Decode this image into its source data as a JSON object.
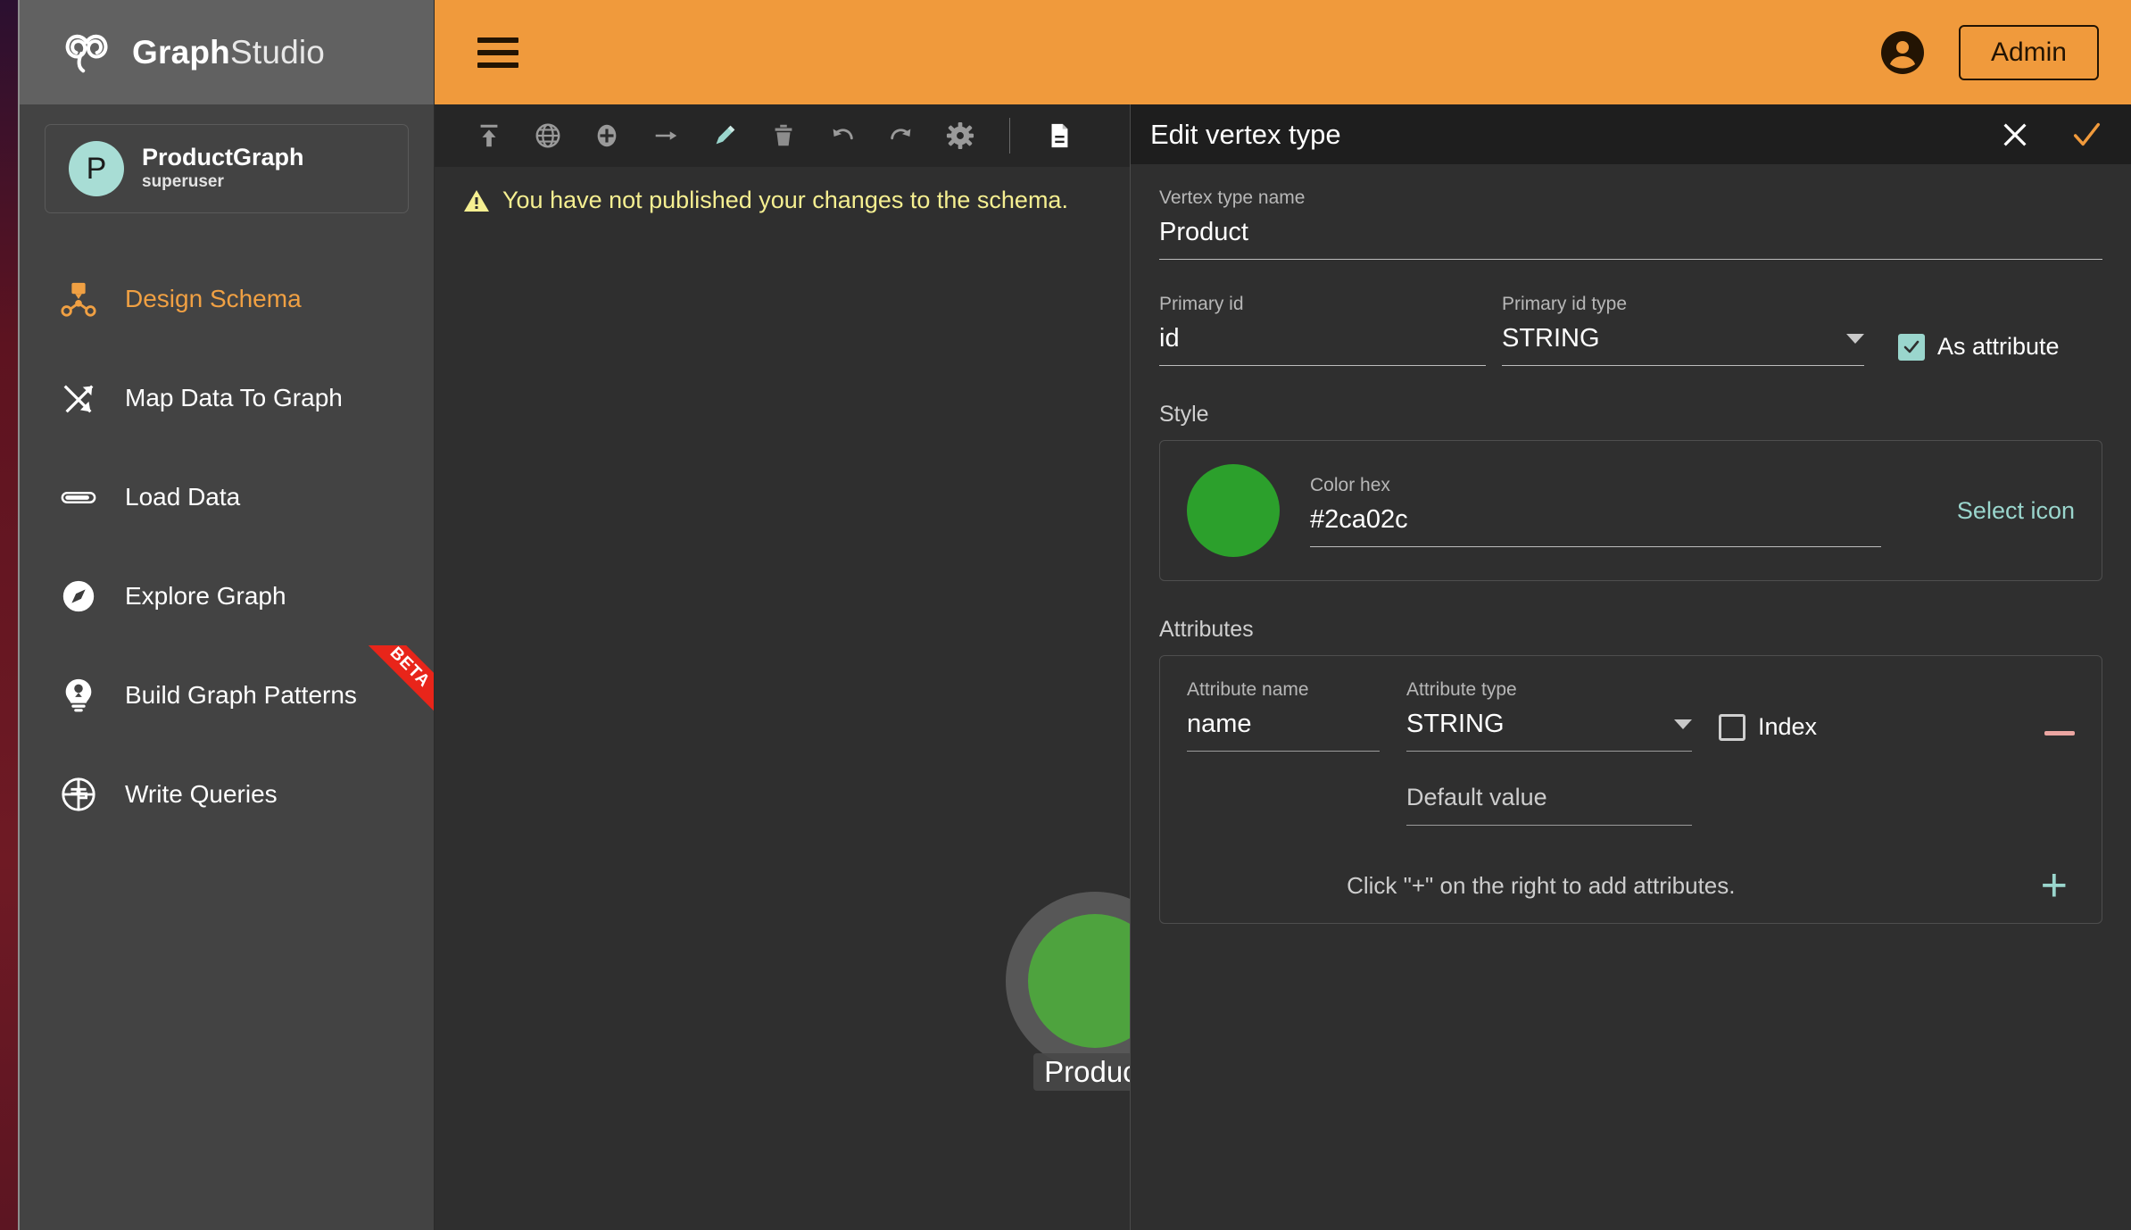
{
  "brand": {
    "name_bold": "Graph",
    "name_thin": "Studio",
    "logo_icon": "infinity-logo-icon"
  },
  "sidebar": {
    "graph_card": {
      "avatar_letter": "P",
      "graph_name": "ProductGraph",
      "role": "superuser"
    },
    "items": [
      {
        "label": "Design Schema",
        "icon": "schema-graph-icon",
        "active": true,
        "badge": ""
      },
      {
        "label": "Map Data To Graph",
        "icon": "shuffle-arrows-icon",
        "active": false,
        "badge": ""
      },
      {
        "label": "Load Data",
        "icon": "progress-bar-icon",
        "active": false,
        "badge": ""
      },
      {
        "label": "Explore Graph",
        "icon": "compass-icon",
        "active": false,
        "badge": ""
      },
      {
        "label": "Build Graph Patterns",
        "icon": "lightbulb-icon",
        "active": false,
        "badge": "BETA"
      },
      {
        "label": "Write Queries",
        "icon": "query-circle-icon",
        "active": false,
        "badge": ""
      }
    ]
  },
  "topbar": {
    "menu_icon": "hamburger-menu-icon",
    "account_icon": "account-circle-icon",
    "admin_label": "Admin"
  },
  "toolbar": {
    "tools": [
      {
        "name": "publish-schema-icon",
        "title": "Publish"
      },
      {
        "name": "globe-icon",
        "title": "Global view"
      },
      {
        "name": "add-vertex-icon",
        "title": "Add vertex"
      },
      {
        "name": "add-edge-icon",
        "title": "Add edge"
      },
      {
        "name": "edit-pencil-icon",
        "title": "Edit",
        "active": true
      },
      {
        "name": "delete-trash-icon",
        "title": "Delete"
      },
      {
        "name": "undo-icon",
        "title": "Undo"
      },
      {
        "name": "redo-icon",
        "title": "Redo"
      },
      {
        "name": "settings-gear-icon",
        "title": "Settings"
      },
      {
        "name": "document-icon",
        "title": "Document"
      }
    ]
  },
  "canvas": {
    "warning": {
      "icon": "warning-triangle-icon",
      "text": "You have not published your changes to the schema."
    },
    "vertex": {
      "label": "Product",
      "color": "#4ea33e",
      "ring_color": "#575757"
    }
  },
  "panel": {
    "title": "Edit vertex type",
    "close_icon": "close-x-icon",
    "confirm_icon": "confirm-check-icon",
    "vertex_type_name": {
      "label": "Vertex type name",
      "value": "Product"
    },
    "primary_id": {
      "label": "Primary id",
      "value": "id"
    },
    "primary_id_type": {
      "label": "Primary id type",
      "value": "STRING"
    },
    "as_attribute": {
      "label": "As attribute",
      "checked": true
    },
    "style": {
      "section_label": "Style",
      "color_hex_label": "Color hex",
      "color_hex_value": "#2ca02c",
      "select_icon_label": "Select icon"
    },
    "attributes": {
      "section_label": "Attributes",
      "name_label": "Attribute name",
      "type_label": "Attribute type",
      "index_label": "Index",
      "default_value_label": "Default value",
      "rows": [
        {
          "name": "name",
          "type": "STRING",
          "index": false,
          "default_value": ""
        }
      ],
      "hint": "Click \"+\" on the right to add attributes.",
      "remove_icon": "remove-attribute-icon",
      "add_icon": "add-attribute-icon"
    }
  },
  "colors": {
    "accent_orange": "#f09a3c",
    "teal": "#9ad6cd",
    "vertex_green": "#4ea33e",
    "warning_yellow": "#f5ef91",
    "beta_red": "#e8251a"
  }
}
